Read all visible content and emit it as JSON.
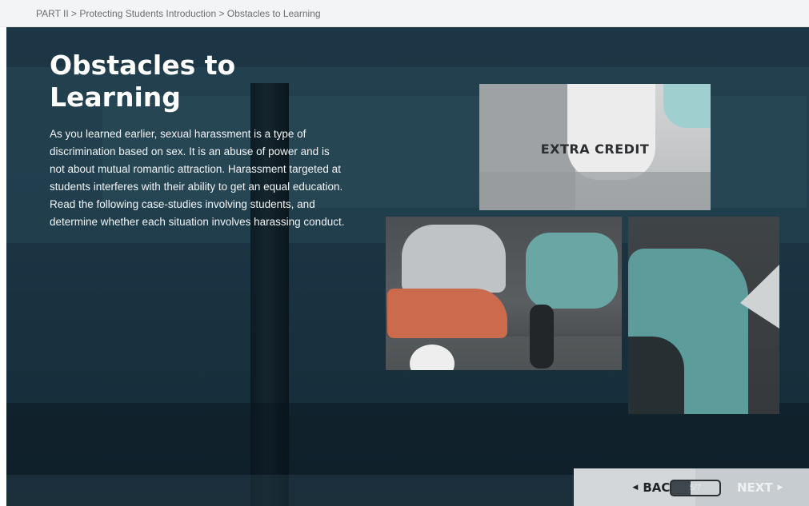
{
  "breadcrumb": "PART II > Protecting Students Introduction > Obstacles to Learning",
  "page": {
    "title_line1": "Obstacles to",
    "title_line2": "Learning",
    "body": "As you learned earlier, sexual harassment is a type of discrimination based on sex. It is an abuse of power and is not about mutual romantic attraction. Harassment targeted at students interferes with their ability to get an equal education. Read the following case-studies involving students, and determine whether each situation involves harassing conduct."
  },
  "tiles": {
    "extra_credit_label": "EXTRA CREDIT"
  },
  "nav": {
    "back_label": "BACK",
    "page_indicator": "5/7",
    "next_label": "NEXT",
    "back_arrow": "◀",
    "next_arrow": "▶"
  },
  "colors": {
    "background": "#1b3443",
    "teal_accent": "#6aa7a4",
    "orange_accent": "#cc6a4e",
    "nav_bg": "#c7ccd0"
  }
}
